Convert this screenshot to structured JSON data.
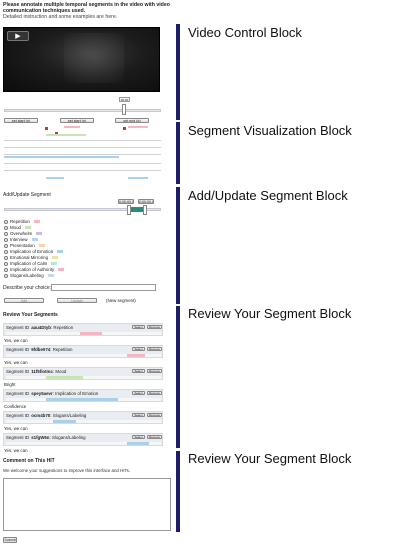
{
  "instructions": {
    "line1": "Please annotate multiple temporal segments in the video with video",
    "line2": "communication techniques used.",
    "line3": "Detailed instruction and some examples are here."
  },
  "video": {
    "play_symbol": "▶",
    "time_marker": "00:00"
  },
  "timeline_buttons": [
    "set start (p)",
    "set start (p)",
    "set end (q)"
  ],
  "add_update": {
    "title": "Add/Update Segment",
    "start_label": "0:00:00.0",
    "end_label": "0:00:00.0",
    "categories": [
      {
        "label": "Repetition",
        "color": "#f4b6c2"
      },
      {
        "label": "Mood",
        "color": "#c9e4b4"
      },
      {
        "label": "Overwhelm",
        "color": "#cbb9e6"
      },
      {
        "label": "Interview",
        "color": "#b6d2ee"
      },
      {
        "label": "Presentation",
        "color": "#f8d3a6"
      },
      {
        "label": "Implication of Emotion",
        "color": "#a9cfe9"
      },
      {
        "label": "Emotional Mirroring",
        "color": "#e6e6a0"
      },
      {
        "label": "Implication of Calm",
        "color": "#b9e3d6"
      },
      {
        "label": "Implication of Authority",
        "color": "#f2b3c7"
      },
      {
        "label": "Slogans/Labeling",
        "color": "#c8d8f0"
      }
    ],
    "describe_label": "Describe your choice:",
    "add_btn": "Add",
    "update_btn": "Update",
    "new_segment": "(New segment)"
  },
  "review": {
    "title": "Review Your Segments",
    "segments": [
      {
        "id_prefix": "Segment ID",
        "id": "aau4Dtyb",
        "category": "Repetition",
        "note": "Yes, we can",
        "color": "#f4b6c2",
        "pos": 0.48,
        "width": 0.14
      },
      {
        "id_prefix": "Segment ID",
        "id": "9fdbe074",
        "category": "Repetition",
        "note": "Yes, we can",
        "color": "#f4b6c2",
        "pos": 0.78,
        "width": 0.12
      },
      {
        "id_prefix": "Segment ID",
        "id": "11f5fiotmc",
        "category": "Mood",
        "note": "Bright",
        "color": "#c9e4b4",
        "pos": 0.26,
        "width": 0.24
      },
      {
        "id_prefix": "Segment ID",
        "id": "spey5aevr",
        "category": "Implication of Emotion",
        "note": "Confidence",
        "color": "#a9cfe9",
        "pos": 0.26,
        "width": 0.46
      },
      {
        "id_prefix": "Segment ID",
        "id": "ocm4b70",
        "category": "Slogans/Labeling",
        "note": "Yes, we can",
        "color": "#a9cfe9",
        "pos": 0.3,
        "width": 0.15
      },
      {
        "id_prefix": "Segment ID",
        "id": "s1fgW6n",
        "category": "Slogans/Labeling",
        "note": "Yes, we can",
        "color": "#a9cfe9",
        "pos": 0.78,
        "width": 0.14
      }
    ],
    "select_btn": "Select",
    "remove_btn": "Remove"
  },
  "comment": {
    "title": "Comment on This HIT",
    "prompt": "We welcome your suggestions to improve this interface and HITs."
  },
  "submit_label": "Submit",
  "callouts": [
    "Video Control Block",
    "Segment Visualization Block",
    "Add/Update Segment Block",
    "Review Your Segment Block",
    "Review Your Segment Block"
  ]
}
